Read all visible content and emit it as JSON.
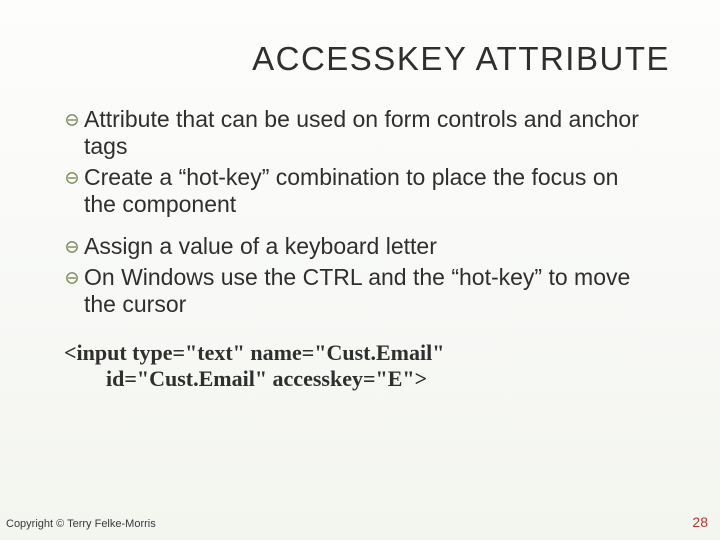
{
  "title": "ACCESSKEY ATTRIBUTE",
  "bullets": {
    "b1": "Attribute that can be used on form controls and anchor tags",
    "b2": "Create a “hot-key” combination to place the focus on the component",
    "b3": "Assign a value of a keyboard letter",
    "b4": "On Windows use the CTRL  and the “hot-key” to move the cursor"
  },
  "code": {
    "line1": "<input  type=\"text\" name=\"Cust.Email\"",
    "line2": "id=\"Cust.Email\" accesskey=\"E\">"
  },
  "footer": {
    "copyright": "Copyright © Terry Felke-Morris",
    "page": "28"
  },
  "colors": {
    "accent_red": "#b03838",
    "bullet_stroke": "#7a8b5a"
  }
}
